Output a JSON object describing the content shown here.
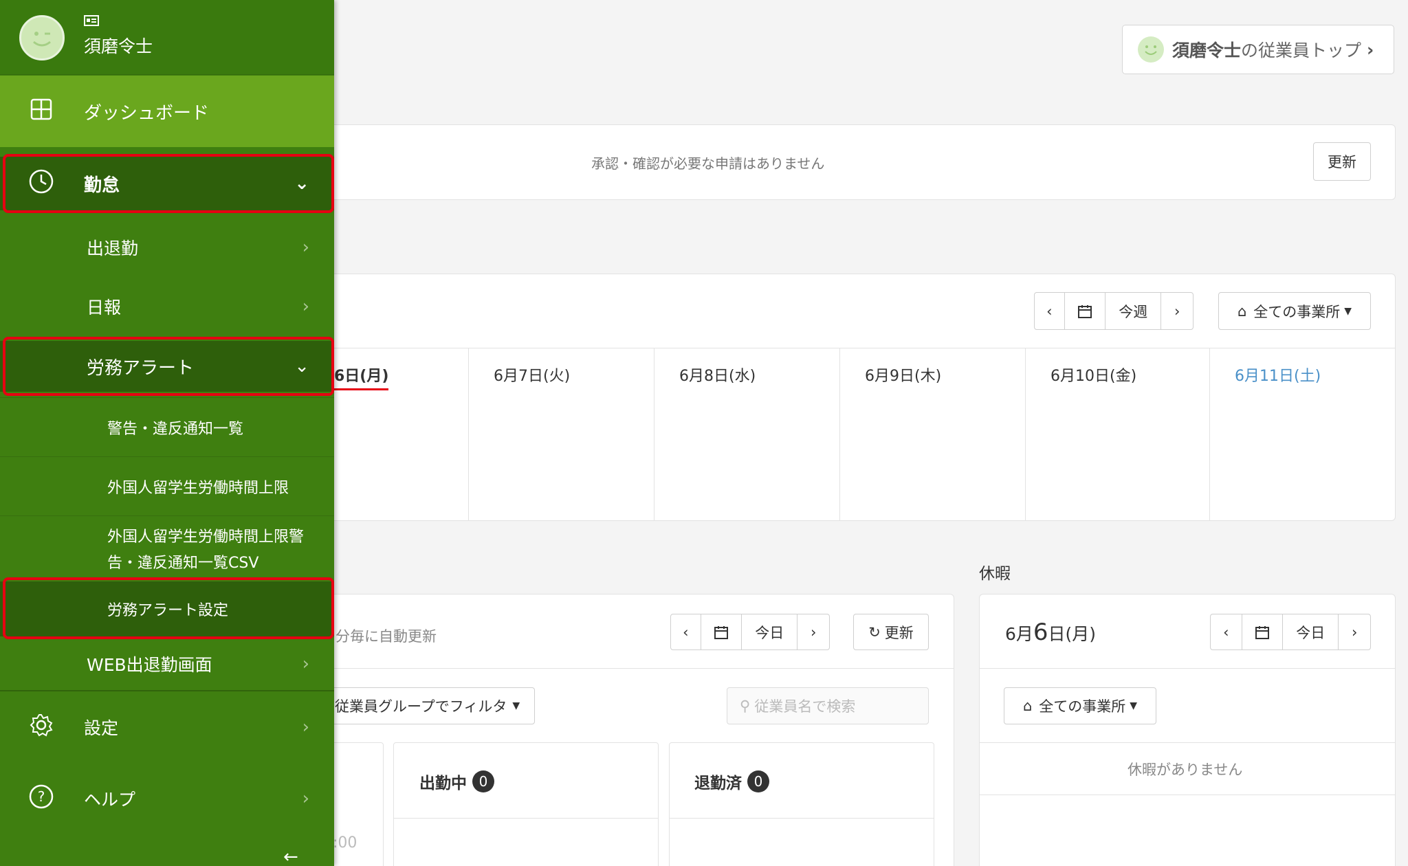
{
  "header": {
    "employee_top_name": "須磨令士",
    "employee_top_suffix": "の従業員トップ"
  },
  "approval": {
    "message": "承認・確認が必要な申請はありません",
    "refresh_label": "更新"
  },
  "week": {
    "today_label": "今週",
    "office_filter": "全ての事業所",
    "days": [
      "6日(月)",
      "6月7日(火)",
      "6月8日(水)",
      "6月9日(木)",
      "6月10日(金)",
      "6月11日(土)"
    ]
  },
  "attendance": {
    "auto_refresh": "分毎に自動更新",
    "today_label": "今日",
    "refresh_label": "更新",
    "group_filter": "従業員グループでフィルタ",
    "search_placeholder": "従業員名で検索",
    "working_label": "出勤中",
    "working_count": "0",
    "left_label": "退勤済",
    "left_count": "0",
    "time_fragment": ":00"
  },
  "vacation": {
    "section_title": "休暇",
    "date_month": "6月",
    "date_day": "6",
    "date_suffix": "日(月)",
    "today_label": "今日",
    "office_filter": "全ての事業所",
    "empty_message": "休暇がありません"
  },
  "sidebar": {
    "user_name": "須磨令士",
    "dashboard": "ダッシュボード",
    "kintai": "勤怠",
    "attendance": "出退勤",
    "daily_report": "日報",
    "labor_alert": "労務アラート",
    "warnings_list": "警告・違反通知一覧",
    "foreign_student_limit": "外国人留学生労働時間上限",
    "foreign_student_csv_line1": "外国人留学生労働時間上限警",
    "foreign_student_csv_line2": "告・違反通知一覧CSV",
    "labor_alert_settings": "労務アラート設定",
    "web_attendance": "WEB出退勤画面",
    "settings": "設定",
    "help": "ヘルプ"
  },
  "colors": {
    "sidebar_bg": "#3f7f10",
    "sidebar_active": "#2e5f0b",
    "dashboard_bg": "#6aa71e",
    "highlight": "#e60012",
    "saturday_blue": "#4a90c8"
  }
}
